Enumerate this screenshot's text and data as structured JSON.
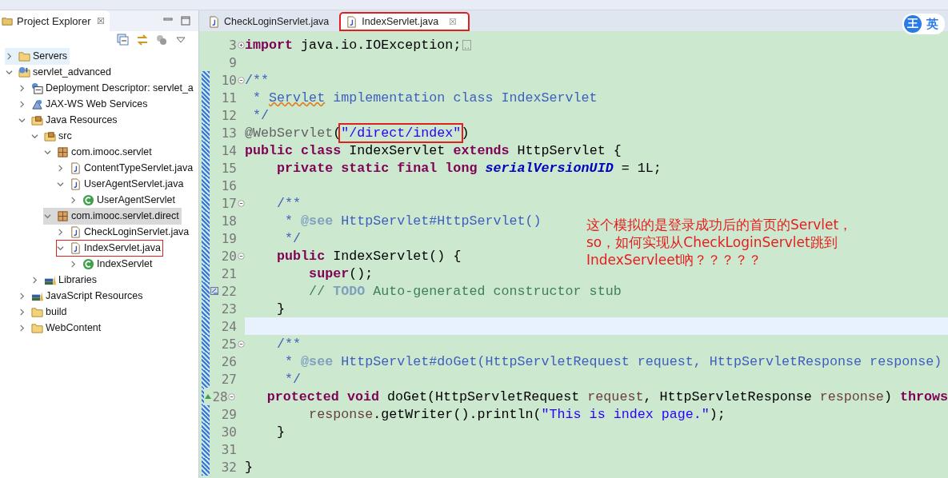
{
  "explorer": {
    "title": "Project Explorer",
    "close": "☒"
  },
  "tree": [
    {
      "label": "Servers",
      "kind": "folder",
      "expanded": false,
      "selected": false,
      "hovered": true,
      "boxed": false
    },
    {
      "label": "servlet_advanced",
      "kind": "project",
      "expanded": true,
      "selected": false,
      "hovered": false,
      "boxed": false,
      "children": [
        {
          "label": "Deployment Descriptor: servlet_a",
          "kind": "descriptor",
          "expanded": false,
          "selected": false,
          "hovered": false,
          "boxed": false
        },
        {
          "label": "JAX-WS Web Services",
          "kind": "webservices",
          "expanded": false,
          "selected": false,
          "hovered": false,
          "boxed": false
        },
        {
          "label": "Java Resources",
          "kind": "resources",
          "expanded": true,
          "selected": false,
          "hovered": false,
          "boxed": false,
          "children": [
            {
              "label": "src",
              "kind": "source",
              "expanded": true,
              "selected": false,
              "hovered": false,
              "boxed": false,
              "children": [
                {
                  "label": "com.imooc.servlet",
                  "kind": "package",
                  "expanded": true,
                  "selected": false,
                  "hovered": false,
                  "boxed": false,
                  "children": [
                    {
                      "label": "ContentTypeServlet.java",
                      "kind": "java",
                      "expanded": false,
                      "selected": false,
                      "hovered": false,
                      "boxed": false
                    },
                    {
                      "label": "UserAgentServlet.java",
                      "kind": "java",
                      "expanded": true,
                      "selected": false,
                      "hovered": false,
                      "boxed": false,
                      "children": [
                        {
                          "label": "UserAgentServlet",
                          "kind": "class",
                          "expanded": false,
                          "selected": false,
                          "hovered": false,
                          "boxed": false
                        }
                      ]
                    }
                  ]
                },
                {
                  "label": "com.imooc.servlet.direct",
                  "kind": "package",
                  "expanded": true,
                  "selected": true,
                  "hovered": false,
                  "boxed": false,
                  "children": [
                    {
                      "label": "CheckLoginServlet.java",
                      "kind": "java",
                      "expanded": false,
                      "selected": false,
                      "hovered": false,
                      "boxed": false
                    },
                    {
                      "label": "IndexServlet.java",
                      "kind": "java",
                      "expanded": true,
                      "selected": false,
                      "hovered": false,
                      "boxed": true,
                      "children": [
                        {
                          "label": "IndexServlet",
                          "kind": "class",
                          "expanded": false,
                          "selected": false,
                          "hovered": false,
                          "boxed": false
                        }
                      ]
                    }
                  ]
                }
              ]
            },
            {
              "label": "Libraries",
              "kind": "library",
              "expanded": false,
              "selected": false,
              "hovered": false,
              "boxed": false
            }
          ]
        },
        {
          "label": "JavaScript Resources",
          "kind": "library",
          "expanded": false,
          "selected": false,
          "hovered": false,
          "boxed": false
        },
        {
          "label": "build",
          "kind": "folder",
          "expanded": false,
          "selected": false,
          "hovered": false,
          "boxed": false
        },
        {
          "label": "WebContent",
          "kind": "folder",
          "expanded": false,
          "selected": false,
          "hovered": false,
          "boxed": false
        }
      ]
    }
  ],
  "tabs": [
    {
      "label": "CheckLoginServlet.java",
      "selected": false,
      "boxed": false
    },
    {
      "label": "IndexServlet.java",
      "selected": true,
      "boxed": true,
      "close": "☒"
    }
  ],
  "ime": {
    "icon": "王",
    "label": "英"
  },
  "lines": [
    {
      "number": "3",
      "foldable": true,
      "collapsed": true,
      "task": false,
      "override": false,
      "changed": false,
      "current": false,
      "segments": [
        {
          "kind": "kw",
          "text": "import"
        },
        {
          "kind": "plain",
          "text": " java.io.IOException;"
        }
      ]
    },
    {
      "number": "9",
      "foldable": false,
      "collapsed": false,
      "task": false,
      "override": false,
      "changed": false,
      "current": false
    },
    {
      "number": "10",
      "foldable": true,
      "collapsed": false,
      "task": false,
      "override": false,
      "changed": true,
      "current": false,
      "segments": [
        {
          "kind": "doc",
          "text": "/**"
        }
      ]
    },
    {
      "number": "11",
      "foldable": false,
      "collapsed": false,
      "task": false,
      "override": false,
      "changed": true,
      "current": false,
      "segments": [
        {
          "kind": "doc",
          "text": " * "
        },
        {
          "kind": "spell",
          "text": "Servlet"
        },
        {
          "kind": "doc",
          "text": " implementation class IndexServlet"
        }
      ]
    },
    {
      "number": "12",
      "foldable": false,
      "collapsed": false,
      "task": false,
      "override": false,
      "changed": true,
      "current": false,
      "segments": [
        {
          "kind": "doc",
          "text": " */"
        }
      ]
    },
    {
      "number": "13",
      "foldable": false,
      "collapsed": false,
      "task": false,
      "override": false,
      "changed": true,
      "current": false,
      "segments": [
        {
          "kind": "annot",
          "text": "@WebServlet"
        },
        {
          "kind": "plain",
          "text": "("
        },
        {
          "kind": "string",
          "text": "\"/direct/index\"",
          "boxed": true
        },
        {
          "kind": "plain",
          "text": ")"
        }
      ]
    },
    {
      "number": "14",
      "foldable": false,
      "collapsed": false,
      "task": false,
      "override": false,
      "changed": true,
      "current": false,
      "segments": [
        {
          "kind": "kw",
          "text": "public class"
        },
        {
          "kind": "plain",
          "text": " IndexServlet "
        },
        {
          "kind": "kw",
          "text": "extends"
        },
        {
          "kind": "plain",
          "text": " HttpServlet {"
        }
      ]
    },
    {
      "number": "15",
      "foldable": false,
      "collapsed": false,
      "task": false,
      "override": false,
      "changed": true,
      "current": false,
      "segments": [
        {
          "kind": "kw",
          "text": "    private static final long"
        },
        {
          "kind": "const",
          "text": " serialVersionUID"
        },
        {
          "kind": "plain",
          "text": " = 1L;"
        }
      ]
    },
    {
      "number": "16",
      "foldable": false,
      "collapsed": false,
      "task": false,
      "override": false,
      "changed": true,
      "current": false
    },
    {
      "number": "17",
      "foldable": true,
      "collapsed": false,
      "task": false,
      "override": false,
      "changed": true,
      "current": false,
      "segments": [
        {
          "kind": "doc",
          "text": "    /**"
        }
      ]
    },
    {
      "number": "18",
      "foldable": false,
      "collapsed": false,
      "task": false,
      "override": false,
      "changed": true,
      "current": false,
      "segments": [
        {
          "kind": "doc",
          "text": "     * "
        },
        {
          "kind": "doctag",
          "text": "@see"
        },
        {
          "kind": "doc",
          "text": " HttpServlet#HttpServlet()"
        }
      ]
    },
    {
      "number": "19",
      "foldable": false,
      "collapsed": false,
      "task": false,
      "override": false,
      "changed": true,
      "current": false,
      "segments": [
        {
          "kind": "doc",
          "text": "     */"
        }
      ]
    },
    {
      "number": "20",
      "foldable": true,
      "collapsed": false,
      "task": false,
      "override": false,
      "changed": true,
      "current": false,
      "segments": [
        {
          "kind": "kw",
          "text": "    public"
        },
        {
          "kind": "plain",
          "text": " IndexServlet() {"
        }
      ]
    },
    {
      "number": "21",
      "foldable": false,
      "collapsed": false,
      "task": false,
      "override": false,
      "changed": true,
      "current": false,
      "segments": [
        {
          "kind": "kw",
          "text": "        super"
        },
        {
          "kind": "plain",
          "text": "();"
        }
      ]
    },
    {
      "number": "22",
      "foldable": false,
      "collapsed": false,
      "task": true,
      "override": false,
      "changed": true,
      "current": false,
      "segments": [
        {
          "kind": "comment",
          "text": "        // "
        },
        {
          "kind": "todo",
          "text": "TODO"
        },
        {
          "kind": "comment",
          "text": " Auto-generated constructor stub"
        }
      ]
    },
    {
      "number": "23",
      "foldable": false,
      "collapsed": false,
      "task": false,
      "override": false,
      "changed": true,
      "current": false,
      "segments": [
        {
          "kind": "plain",
          "text": "    }"
        }
      ]
    },
    {
      "number": "24",
      "foldable": false,
      "collapsed": false,
      "task": false,
      "override": false,
      "changed": true,
      "current": true
    },
    {
      "number": "25",
      "foldable": true,
      "collapsed": false,
      "task": false,
      "override": false,
      "changed": true,
      "current": false,
      "segments": [
        {
          "kind": "doc",
          "text": "    /**"
        }
      ]
    },
    {
      "number": "26",
      "foldable": false,
      "collapsed": false,
      "task": false,
      "override": false,
      "changed": true,
      "current": false,
      "segments": [
        {
          "kind": "doc",
          "text": "     * "
        },
        {
          "kind": "doctag",
          "text": "@see"
        },
        {
          "kind": "doc",
          "text": " HttpServlet#doGet(HttpServletRequest request, HttpServletResponse response)"
        }
      ]
    },
    {
      "number": "27",
      "foldable": false,
      "collapsed": false,
      "task": false,
      "override": false,
      "changed": true,
      "current": false,
      "segments": [
        {
          "kind": "doc",
          "text": "     */"
        }
      ]
    },
    {
      "number": "28",
      "foldable": true,
      "collapsed": false,
      "task": false,
      "override": true,
      "changed": true,
      "current": false,
      "segments": [
        {
          "kind": "kw",
          "text": "    protected void"
        },
        {
          "kind": "plain",
          "text": " doGet(HttpServletRequest "
        },
        {
          "kind": "param",
          "text": "request"
        },
        {
          "kind": "plain",
          "text": ", HttpServletResponse "
        },
        {
          "kind": "param",
          "text": "response"
        },
        {
          "kind": "plain",
          "text": ") "
        },
        {
          "kind": "kw",
          "text": "throws"
        }
      ]
    },
    {
      "number": "29",
      "foldable": false,
      "collapsed": false,
      "task": false,
      "override": false,
      "changed": true,
      "current": false,
      "segments": [
        {
          "kind": "param",
          "text": "        response"
        },
        {
          "kind": "plain",
          "text": ".getWriter().println("
        },
        {
          "kind": "string",
          "text": "\"This is index page.\""
        },
        {
          "kind": "plain",
          "text": ");"
        }
      ]
    },
    {
      "number": "30",
      "foldable": false,
      "collapsed": false,
      "task": false,
      "override": false,
      "changed": true,
      "current": false,
      "segments": [
        {
          "kind": "plain",
          "text": "    }"
        }
      ]
    },
    {
      "number": "31",
      "foldable": false,
      "collapsed": false,
      "task": false,
      "override": false,
      "changed": true,
      "current": false
    },
    {
      "number": "32",
      "foldable": false,
      "collapsed": false,
      "task": false,
      "override": false,
      "changed": true,
      "current": false,
      "segments": [
        {
          "kind": "plain",
          "text": "}"
        }
      ]
    }
  ],
  "note": {
    "lines": [
      "这个模拟的是登录成功后的首页的Servlet，",
      "so，如何实现从CheckLoginServlet跳到",
      "IndexServleet吶？？？？？"
    ]
  }
}
